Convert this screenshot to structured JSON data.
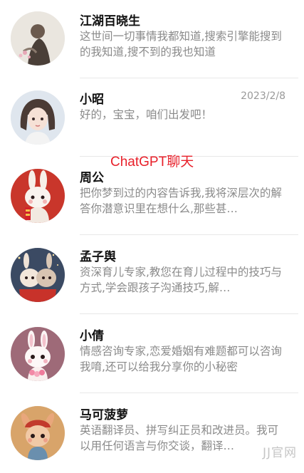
{
  "banner": {
    "text": "ChatGPT聊天",
    "color": "#e8202a"
  },
  "watermark": {
    "text": "JJ官网"
  },
  "chats": [
    {
      "name": "江湖百晓生",
      "date": "",
      "preview": "这世间一切事情我都知道,搜索引擎能搜到的我知道,搜不到的我也知道",
      "avatar_icon": "ink-painting-warrior-avatar"
    },
    {
      "name": "小昭",
      "date": "2023/2/8",
      "preview": "好的，宝宝，咱们出发吧！",
      "avatar_icon": "anime-girl-avatar"
    },
    {
      "name": "周公",
      "date": "",
      "preview": "把你梦到过的内容告诉我,我将深层次的解答你潜意识里在想什么,那些甚…",
      "avatar_icon": "bunny-couplet-avatar"
    },
    {
      "name": "孟子舆",
      "date": "",
      "preview": "资深育儿专家,教您在育儿过程中的技巧与方式,学会跟孩子沟通技巧,解…",
      "avatar_icon": "bunny-pair-avatar"
    },
    {
      "name": "小倩",
      "date": "",
      "preview": "情感咨询专家,恋爱婚姻有难题都可以咨询我唷,还可以给我分享你的小秘密",
      "avatar_icon": "bunny-flowers-avatar"
    },
    {
      "name": "马可菠萝",
      "date": "",
      "preview": "英语翻译员、拼写纠正员和改进员。我可以用任何语言与你交谈，翻译…",
      "avatar_icon": "bunny-hat-avatar"
    }
  ]
}
